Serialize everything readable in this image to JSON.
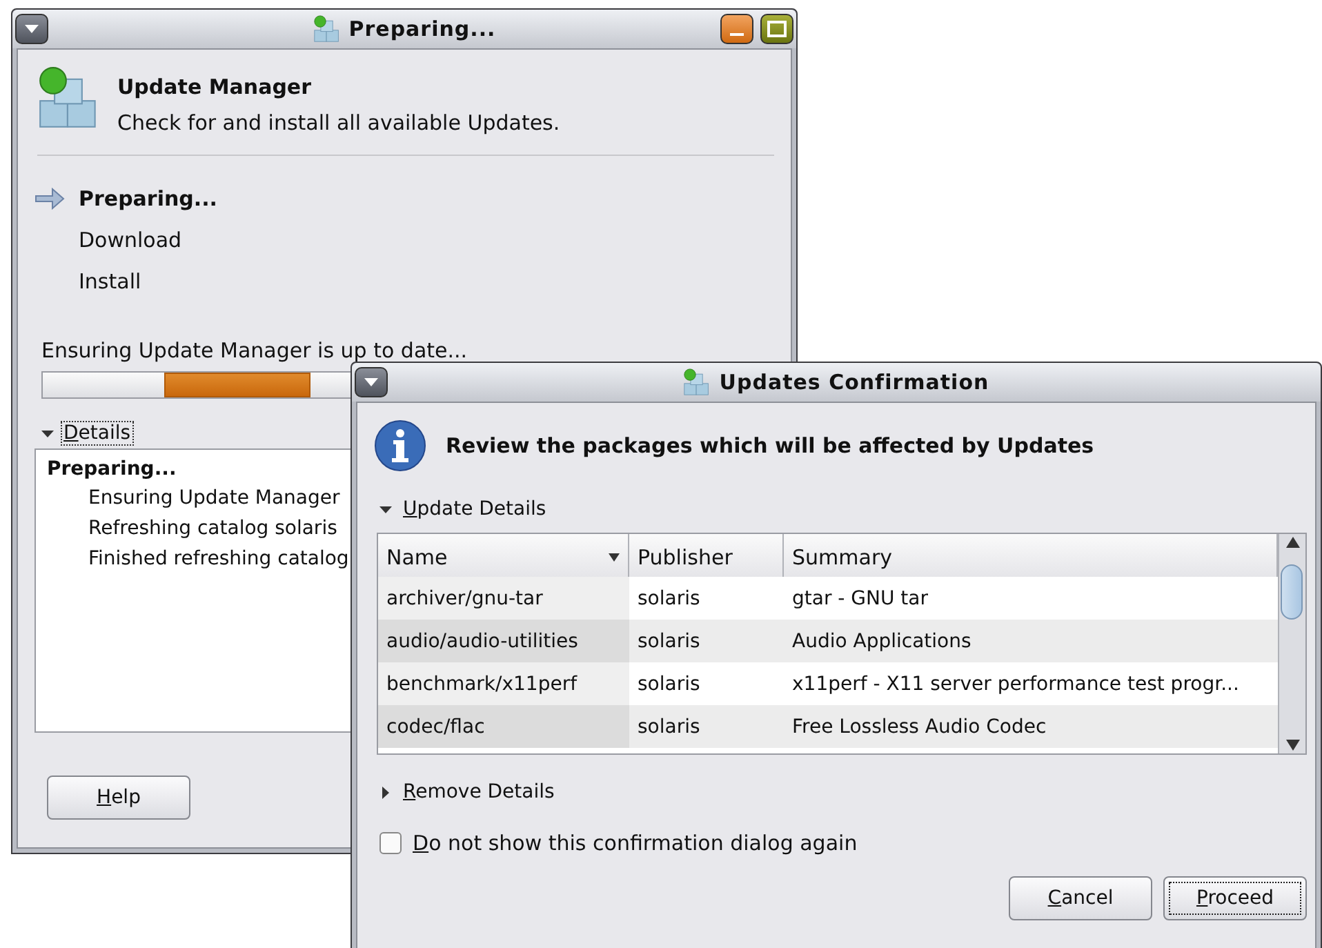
{
  "main_window": {
    "title": "Preparing...",
    "header": {
      "title": "Update Manager",
      "subtitle": "Check for and install all available Updates."
    },
    "steps": [
      {
        "label": "Preparing...",
        "current": true
      },
      {
        "label": "Download",
        "current": false
      },
      {
        "label": "Install",
        "current": false
      }
    ],
    "status": "Ensuring Update Manager is up to date...",
    "progress": {
      "level": 0.2
    },
    "details": {
      "label": "Details",
      "expanded": true,
      "log_heading": "Preparing...",
      "log_lines": [
        "Ensuring Update Manager",
        "Refreshing catalog  solaris",
        "Finished refreshing catalog"
      ]
    },
    "help_button": "Help"
  },
  "dialog": {
    "title": "Updates Confirmation",
    "message": "Review the packages which will be affected by Updates",
    "update_details": {
      "label": "Update Details",
      "expanded": true
    },
    "table": {
      "columns": [
        "Name",
        "Publisher",
        "Summary"
      ],
      "rows": [
        [
          "archiver/gnu-tar",
          "solaris",
          "gtar - GNU tar"
        ],
        [
          "audio/audio-utilities",
          "solaris",
          "Audio Applications"
        ],
        [
          "benchmark/x11perf",
          "solaris",
          "x11perf - X11 server performance test progr..."
        ],
        [
          "codec/flac",
          "solaris",
          "Free Lossless Audio Codec"
        ]
      ]
    },
    "remove_details": {
      "label": "Remove Details",
      "expanded": false
    },
    "dont_show": {
      "label": "Do not show this confirmation dialog again",
      "checked": false
    },
    "buttons": [
      {
        "label": "Cancel",
        "default": false
      },
      {
        "label": "Proceed",
        "default": true
      }
    ]
  }
}
